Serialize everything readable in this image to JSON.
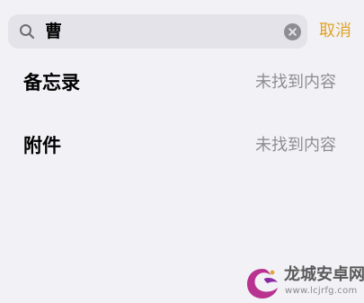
{
  "search": {
    "query": "曹",
    "cancel_label": "取消"
  },
  "results": [
    {
      "title": "备忘录",
      "status": "未找到内容"
    },
    {
      "title": "附件",
      "status": "未找到内容"
    }
  ],
  "watermark": {
    "title": "龙城安卓网",
    "url": "www.lcjrfg.com"
  },
  "colors": {
    "accent": "#e0a425",
    "background": "#f2f1f6",
    "field": "#e4e3e9",
    "secondary_text": "#8e8d93"
  },
  "icons": {
    "search": "search-icon",
    "clear": "clear-icon",
    "logo": "site-logo-icon"
  }
}
